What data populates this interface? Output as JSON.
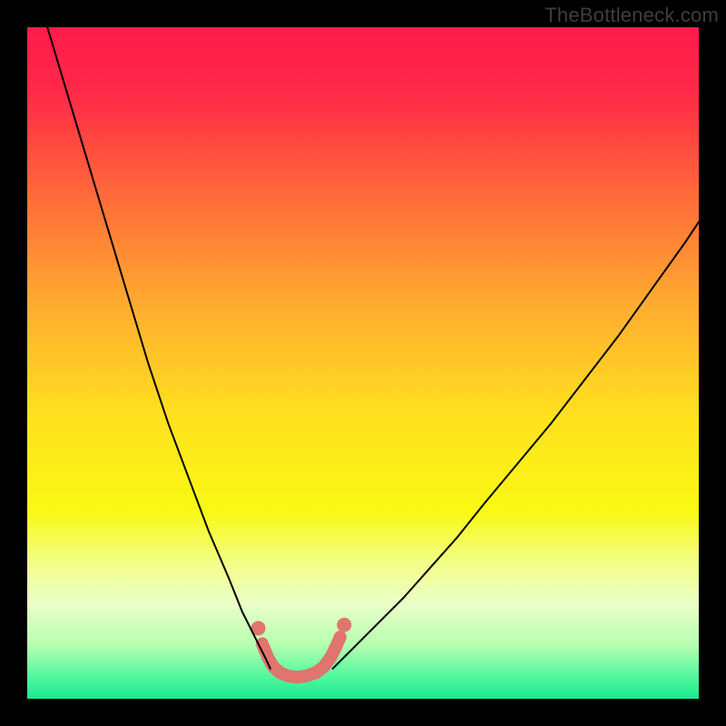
{
  "watermark": "TheBottleneck.com",
  "chart_data": {
    "type": "line",
    "title": "",
    "xlabel": "",
    "ylabel": "",
    "xlim": [
      0,
      100
    ],
    "ylim": [
      0,
      100
    ],
    "grid": false,
    "legend": false,
    "annotations": [],
    "background_gradient_stops": [
      {
        "offset": 0.0,
        "color": "#ff1a4b"
      },
      {
        "offset": 0.1,
        "color": "#ff2a47"
      },
      {
        "offset": 0.25,
        "color": "#ff6a3a"
      },
      {
        "offset": 0.42,
        "color": "#ffae2f"
      },
      {
        "offset": 0.58,
        "color": "#ffe11e"
      },
      {
        "offset": 0.72,
        "color": "#f9f913"
      },
      {
        "offset": 0.8,
        "color": "#f2ff8a"
      },
      {
        "offset": 0.86,
        "color": "#eaffc8"
      },
      {
        "offset": 0.92,
        "color": "#b6ffb0"
      },
      {
        "offset": 0.97,
        "color": "#4cf79e"
      },
      {
        "offset": 1.0,
        "color": "#18e88e"
      }
    ],
    "series": [
      {
        "name": "left-branch",
        "stroke": "#000000",
        "stroke_width": 2,
        "x": [
          3,
          6,
          9,
          12,
          15,
          18,
          21,
          24,
          27,
          30,
          32,
          34,
          35.5,
          36.2
        ],
        "y": [
          100,
          90,
          80,
          70,
          60,
          50,
          41,
          33,
          25,
          18,
          13,
          9,
          6,
          4.5
        ]
      },
      {
        "name": "right-branch",
        "stroke": "#000000",
        "stroke_width": 2,
        "x": [
          45.5,
          47,
          49,
          52,
          56,
          60,
          64,
          68,
          73,
          78,
          83,
          88,
          93,
          98,
          100
        ],
        "y": [
          4.5,
          6,
          8,
          11,
          15,
          19.5,
          24,
          29,
          35,
          41,
          47.5,
          54,
          61,
          68,
          71
        ]
      },
      {
        "name": "valley-floor",
        "stroke": "#e0746e",
        "stroke_width": 14,
        "linecap": "round",
        "x": [
          35.0,
          35.8,
          36.6,
          37.6,
          38.8,
          40.2,
          41.6,
          43.0,
          44.2,
          45.2,
          46.0,
          46.6
        ],
        "y": [
          8.2,
          6.2,
          4.8,
          3.9,
          3.4,
          3.2,
          3.4,
          3.9,
          4.8,
          6.2,
          7.8,
          9.2
        ]
      }
    ],
    "markers": [
      {
        "x": 34.4,
        "y": 10.5,
        "r": 8,
        "fill": "#e0746e"
      },
      {
        "x": 47.2,
        "y": 11.0,
        "r": 8,
        "fill": "#e0746e"
      }
    ]
  }
}
